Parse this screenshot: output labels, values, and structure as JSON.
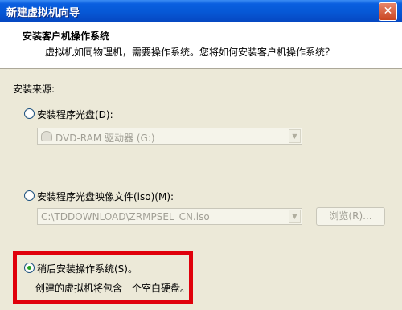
{
  "window": {
    "title": "新建虚拟机向导",
    "close_glyph": "✕"
  },
  "header": {
    "title": "安装客户机操作系统",
    "description": "虚拟机如同物理机，需要操作系统。您将如何安装客户机操作系统？"
  },
  "install_source": {
    "label": "安装来源:",
    "options": [
      {
        "label": "安装程序光盘(D):",
        "selected": false,
        "enabled": true
      },
      {
        "label": "安装程序光盘映像文件(iso)(M):",
        "selected": false,
        "enabled": true
      },
      {
        "label": "稍后安装操作系统(S)。",
        "selected": true,
        "enabled": true
      }
    ],
    "disc_drive": {
      "value": "DVD-RAM 驱动器 (G:)",
      "icon": "dvd-drive-icon",
      "enabled": false
    },
    "iso_path": {
      "value": "C:\\TDDOWNLOAD\\ZRMPSEL_CN.iso",
      "enabled": false
    },
    "browse_label": "浏览(R)...",
    "later_description": "创建的虚拟机将包含一个空白硬盘。"
  },
  "colors": {
    "highlight": "#e0000b",
    "selected_radio": "#21a121",
    "titlebar": "#0658d6"
  }
}
